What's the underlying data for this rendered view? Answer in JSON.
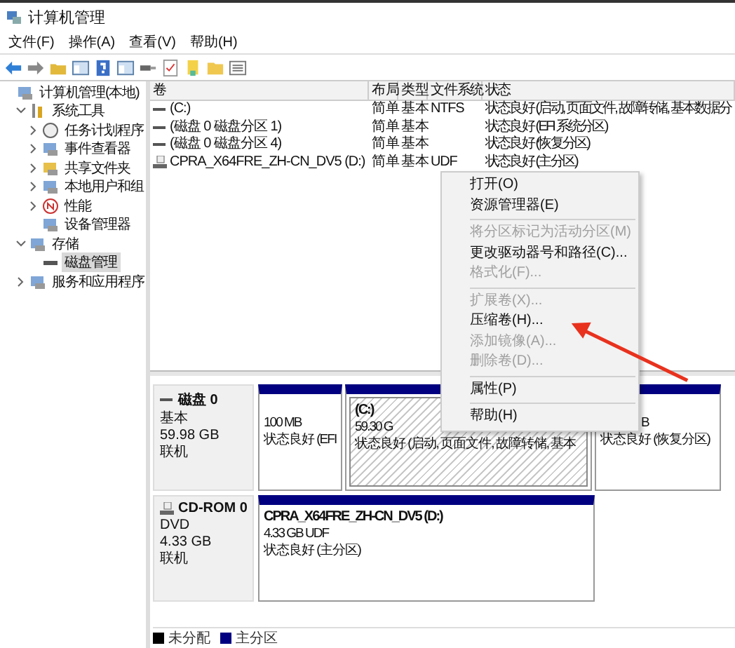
{
  "window": {
    "title": "计算机管理"
  },
  "menu_bar": [
    "文件(F)",
    "操作(A)",
    "查看(V)",
    "帮助(H)"
  ],
  "tree": [
    {
      "label": "计算机管理(本地)",
      "selected": false,
      "children": [
        {
          "label": "系统工具",
          "expanded": true,
          "selected": false,
          "children": [
            {
              "label": "任务计划程序",
              "expanded": false,
              "selected": false
            },
            {
              "label": "事件查看器",
              "expanded": false,
              "selected": false
            },
            {
              "label": "共享文件夹",
              "expanded": false,
              "selected": false
            },
            {
              "label": "本地用户和组",
              "expanded": false,
              "selected": false
            },
            {
              "label": "性能",
              "expanded": false,
              "selected": false
            },
            {
              "label": "设备管理器",
              "selected": false
            }
          ]
        },
        {
          "label": "存储",
          "expanded": true,
          "selected": false,
          "children": [
            {
              "label": "磁盘管理",
              "selected": true
            }
          ]
        },
        {
          "label": "服务和应用程序",
          "expanded": false,
          "selected": false
        }
      ]
    }
  ],
  "volume_list": {
    "columns": [
      "卷",
      "布局",
      "类型",
      "文件系统",
      "状态"
    ],
    "rows": [
      {
        "kind": "partition",
        "volume": "(C:)",
        "layout": "简单",
        "type": "基本",
        "file_system": "NTFS",
        "status": "状态良好 (启动, 页面文件, 故障转储, 基本数据分"
      },
      {
        "kind": "partition",
        "volume": "(磁盘 0 磁盘分区 1)",
        "layout": "简单",
        "type": "基本",
        "status": "状态良好 (EFI 系统分区)"
      },
      {
        "kind": "partition",
        "volume": "(磁盘 0 磁盘分区 4)",
        "layout": "简单",
        "type": "基本",
        "status": "状态良好 (恢复分区)"
      },
      {
        "kind": "optical",
        "volume": "CPRA_X64FRE_ZH-CN_DV5 (D:)",
        "layout": "简单",
        "type": "基本",
        "file_system": "UDF",
        "status": "状态良好 (主分区)"
      }
    ]
  },
  "disks": [
    {
      "kind": "disk",
      "name": "磁盘 0",
      "type": "基本",
      "size": "59.98 GB",
      "status": "联机",
      "partitions": [
        {
          "size": "100 MB",
          "status": "状态良好 (EFI",
          "selected": false
        },
        {
          "label": "(C:)",
          "size": "59.30 G",
          "status": "状态良好 (启动, 页面文件, 故障转储, 基本",
          "selected": true
        },
        {
          "size": "B",
          "status": "状态良好 (恢复分区)",
          "selected": false
        }
      ]
    },
    {
      "kind": "optical",
      "name": "CD-ROM 0",
      "type": "DVD",
      "size": "4.33 GB",
      "status": "联机",
      "partitions": [
        {
          "label": "CPRA_X64FRE_ZH-CN_DV5  (D:)",
          "size": "4.33 GB UDF",
          "status": "状态良好 (主分区)",
          "selected": false
        }
      ]
    }
  ],
  "legend": [
    {
      "label": "未分配",
      "color": "#000000"
    },
    {
      "label": "主分区",
      "color": "#000080"
    }
  ],
  "context_menu": [
    {
      "kind": "item",
      "label": "打开(O)",
      "disabled": false
    },
    {
      "kind": "item",
      "label": "资源管理器(E)",
      "disabled": false
    },
    {
      "kind": "separator"
    },
    {
      "kind": "item",
      "label": "将分区标记为活动分区(M)",
      "disabled": true
    },
    {
      "kind": "item",
      "label": "更改驱动器号和路径(C)...",
      "disabled": false
    },
    {
      "kind": "item",
      "label": "格式化(F)...",
      "disabled": true
    },
    {
      "kind": "separator"
    },
    {
      "kind": "item",
      "label": "扩展卷(X)...",
      "disabled": true
    },
    {
      "kind": "item",
      "label": "压缩卷(H)...",
      "disabled": false
    },
    {
      "kind": "item",
      "label": "添加镜像(A)...",
      "disabled": true
    },
    {
      "kind": "item",
      "label": "删除卷(D)...",
      "disabled": true
    },
    {
      "kind": "separator"
    },
    {
      "kind": "item",
      "label": "属性(P)",
      "disabled": false
    },
    {
      "kind": "separator"
    },
    {
      "kind": "item",
      "label": "帮助(H)",
      "disabled": false
    }
  ]
}
